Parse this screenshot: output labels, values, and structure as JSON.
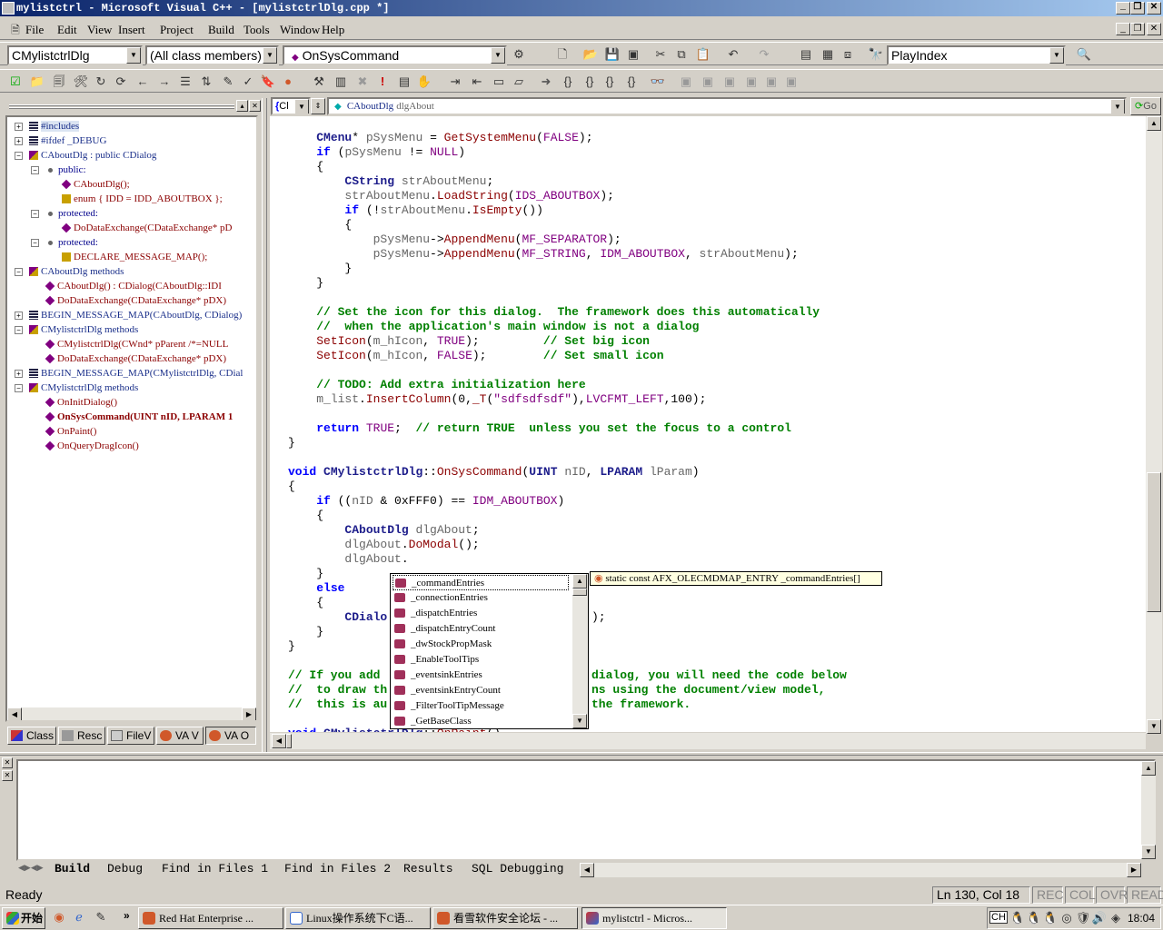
{
  "window": {
    "title": "mylistctrl - Microsoft Visual C++ - [mylistctrlDlg.cpp *]"
  },
  "menu": [
    "File",
    "Edit",
    "View",
    "Insert",
    "Project",
    "Build",
    "Tools",
    "Window",
    "Help"
  ],
  "toolbar": {
    "class_combo": "CMylistctrlDlg",
    "filter_combo": "(All class members)",
    "member_combo": "OnSysCommand",
    "find_combo": "PlayIndex"
  },
  "wizardbar": {
    "context_short": "Cl",
    "context": "CAboutDlg",
    "context_var": "dlgAbout",
    "go_label": "Go"
  },
  "tree": [
    {
      "text": "#includes",
      "kind": "folder"
    },
    {
      "text": "#ifdef _DEBUG",
      "kind": "folder"
    },
    {
      "text": "CAboutDlg : public CDialog",
      "kind": "class"
    },
    {
      "text": "public:",
      "kind": "access"
    },
    {
      "text": "CAboutDlg();",
      "kind": "method"
    },
    {
      "text": "enum { IDD = IDD_ABOUTBOX };",
      "kind": "enum"
    },
    {
      "text": "protected:",
      "kind": "access"
    },
    {
      "text": "DoDataExchange(CDataExchange* pD",
      "kind": "method"
    },
    {
      "text": "protected:",
      "kind": "access"
    },
    {
      "text": "DECLARE_MESSAGE_MAP();",
      "kind": "macro"
    },
    {
      "text": "CAboutDlg methods",
      "kind": "class"
    },
    {
      "text": "CAboutDlg() : CDialog(CAboutDlg::IDI",
      "kind": "method"
    },
    {
      "text": "DoDataExchange(CDataExchange* pDX)",
      "kind": "method"
    },
    {
      "text": "BEGIN_MESSAGE_MAP(CAboutDlg, CDialog)",
      "kind": "folder"
    },
    {
      "text": "CMylistctrlDlg methods",
      "kind": "class"
    },
    {
      "text": "CMylistctrlDlg(CWnd* pParent /*=NULL",
      "kind": "method"
    },
    {
      "text": "DoDataExchange(CDataExchange* pDX)",
      "kind": "method"
    },
    {
      "text": "BEGIN_MESSAGE_MAP(CMylistctrlDlg, CDial",
      "kind": "folder"
    },
    {
      "text": "CMylistctrlDlg methods",
      "kind": "class"
    },
    {
      "text": "OnInitDialog()",
      "kind": "method"
    },
    {
      "text": "OnSysCommand(UINT nID, LPARAM 1",
      "kind": "method"
    },
    {
      "text": "OnPaint()",
      "kind": "method"
    },
    {
      "text": "OnQueryDragIcon()",
      "kind": "method"
    }
  ],
  "left_tabs": [
    "Class",
    "Resc",
    "FileV",
    "VA V",
    "VA O"
  ],
  "code_lines": [
    "    CMenu* pSysMenu = GetSystemMenu(FALSE);",
    "    if (pSysMenu != NULL)",
    "    {",
    "        CString strAboutMenu;",
    "        strAboutMenu.LoadString(IDS_ABOUTBOX);",
    "        if (!strAboutMenu.IsEmpty())",
    "        {",
    "            pSysMenu->AppendMenu(MF_SEPARATOR);",
    "            pSysMenu->AppendMenu(MF_STRING, IDM_ABOUTBOX, strAboutMenu);",
    "        }",
    "    }",
    "",
    "    // Set the icon for this dialog.  The framework does this automatically",
    "    //  when the application's main window is not a dialog",
    "    SetIcon(m_hIcon, TRUE);         // Set big icon",
    "    SetIcon(m_hIcon, FALSE);        // Set small icon",
    "",
    "    // TODO: Add extra initialization here",
    "    m_list.InsertColumn(0,_T(\"sdfsdfsdf\"),LVCFMT_LEFT,100);",
    "",
    "    return TRUE;  // return TRUE  unless you set the focus to a control",
    "}",
    "",
    "void CMylistctrlDlg::OnSysCommand(UINT nID, LPARAM lParam)",
    "{",
    "    if ((nID & 0xFFF0) == IDM_ABOUTBOX)",
    "    {",
    "        CAboutDlg dlgAbout;",
    "        dlgAbout.DoModal();",
    "        dlgAbout.",
    "    }",
    "    else",
    "    {",
    "        CDialo",
    "    }",
    "}",
    "",
    "// If you add",
    "//  to draw th",
    "//  this is au",
    "",
    "void CMylistctrlDlg::OnPaint()"
  ],
  "code_tails": {
    "l33": ");",
    "l37": "dialog, you will need the code below",
    "l38": "ns using the document/view model,",
    "l39": "the framework."
  },
  "autocomplete": {
    "items": [
      "_commandEntries",
      "_connectionEntries",
      "_dispatchEntries",
      "_dispatchEntryCount",
      "_dwStockPropMask",
      "_EnableToolTips",
      "_eventsinkEntries",
      "_eventsinkEntryCount",
      "_FilterToolTipMessage",
      "_GetBaseClass"
    ],
    "selected": 0,
    "tooltip": "static const AFX_OLECMDMAP_ENTRY _commandEntries[]"
  },
  "output_tabs": [
    "Build",
    "Debug",
    "Find in Files 1",
    "Find in Files 2",
    "Results",
    "SQL Debugging"
  ],
  "status": {
    "text": "Ready",
    "position": "Ln 130, Col 18",
    "indicators": [
      "REC",
      "COL",
      "OVR",
      "READ"
    ]
  },
  "taskbar": {
    "start": "开始",
    "tasks": [
      "Red Hat Enterprise ...",
      "Linux操作系统下C语...",
      "看雪软件安全论坛 - ...",
      "mylistctrl - Micros..."
    ],
    "tray_lang": "CH",
    "clock": "18:04"
  }
}
